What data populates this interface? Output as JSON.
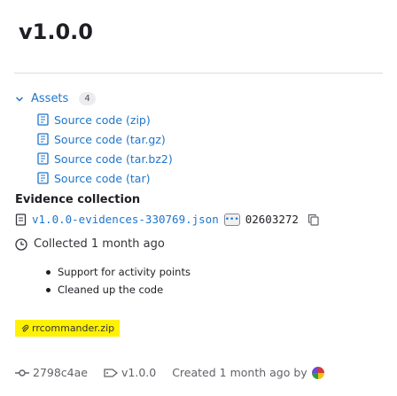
{
  "release": {
    "title": "v1.0.0"
  },
  "assets": {
    "label": "Assets",
    "count": "4",
    "items": [
      {
        "label": "Source code (zip)"
      },
      {
        "label": "Source code (tar.gz)"
      },
      {
        "label": "Source code (tar.bz2)"
      },
      {
        "label": "Source code (tar)"
      }
    ]
  },
  "evidence": {
    "title": "Evidence collection",
    "file_name": "v1.0.0-evidences-330769.json",
    "ellipsis": "•••",
    "sha": "02603272",
    "collected": "Collected 1 month ago"
  },
  "notes": [
    "Support for activity points",
    "Cleaned up the code"
  ],
  "attachment": {
    "label": "rrcommander.zip"
  },
  "footer": {
    "commit": "2798c4ae",
    "tag": "v1.0.0",
    "created": "Created 1 month ago by"
  },
  "colors": {
    "link": "#1f75cb",
    "highlight": "#fff200",
    "text": "#333238"
  }
}
